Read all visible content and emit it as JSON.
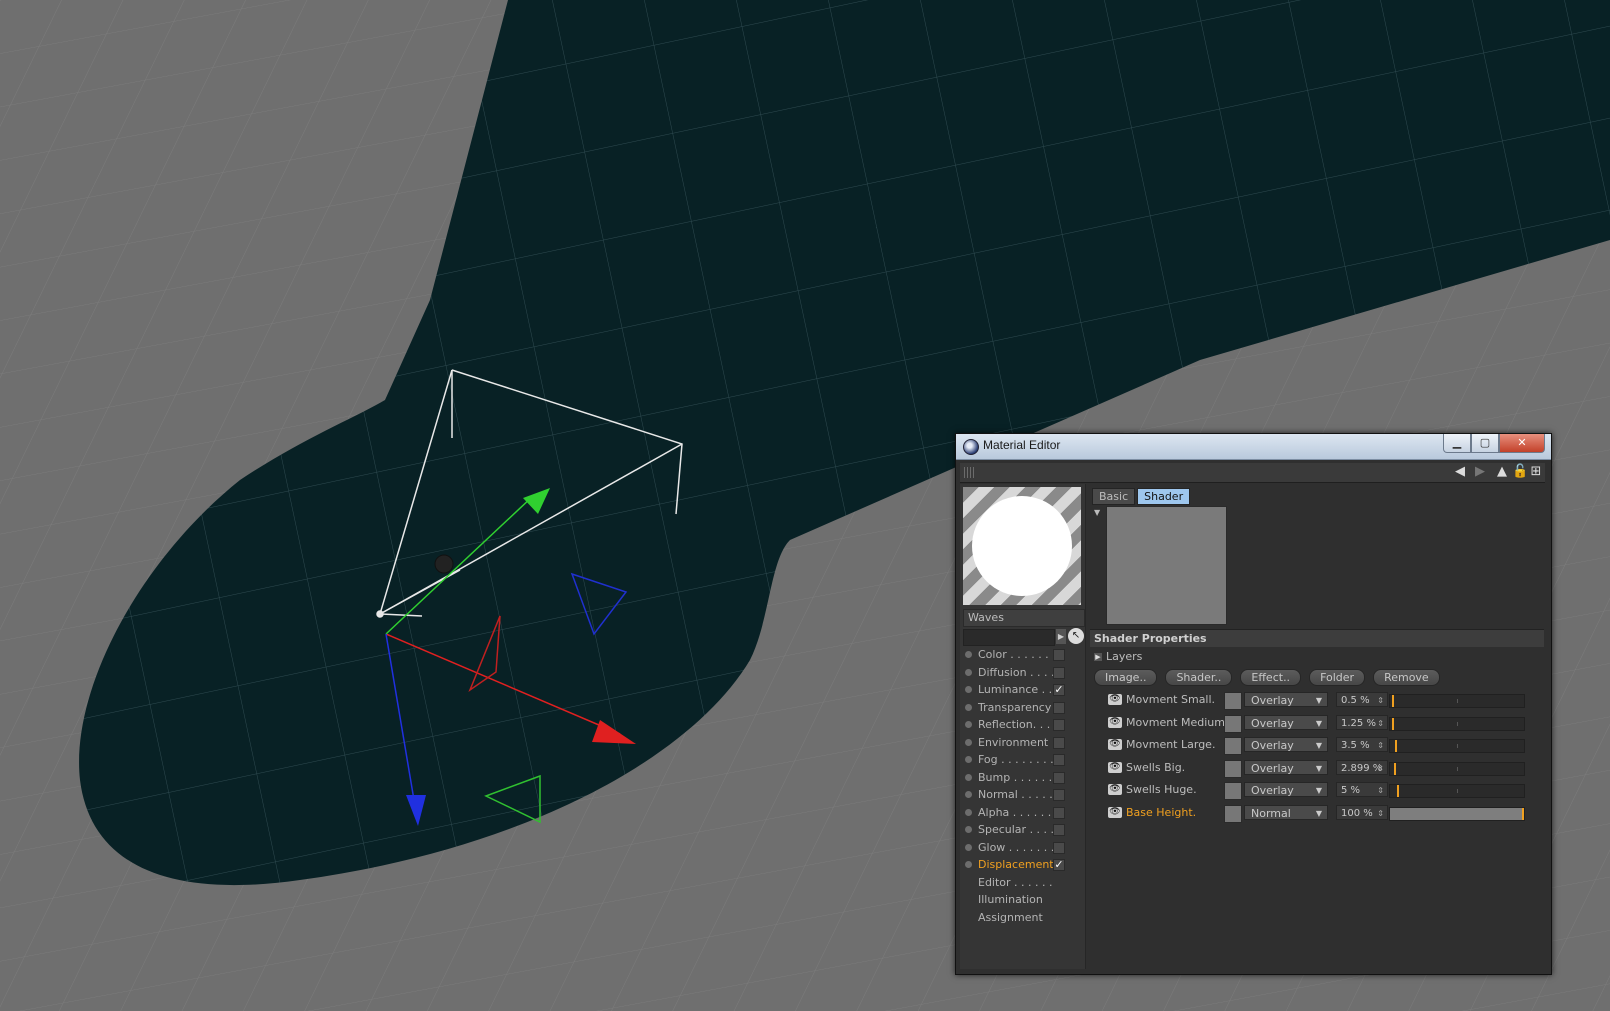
{
  "window": {
    "title": "Material Editor",
    "buttons": {
      "minimize": "▁",
      "maximize": "▢",
      "close": "✕"
    }
  },
  "material": {
    "name": "Waves"
  },
  "channels": [
    {
      "label": "Color . . . . . . .",
      "checked": false,
      "active": false,
      "has_checkbox": true
    },
    {
      "label": "Diffusion . . . . .",
      "checked": false,
      "active": false,
      "has_checkbox": true
    },
    {
      "label": "Luminance . . .",
      "checked": true,
      "active": false,
      "has_checkbox": true
    },
    {
      "label": "Transparency",
      "checked": false,
      "active": false,
      "has_checkbox": true
    },
    {
      "label": "Reflection. . . .",
      "checked": false,
      "active": false,
      "has_checkbox": true
    },
    {
      "label": "Environment",
      "checked": false,
      "active": false,
      "has_checkbox": true
    },
    {
      "label": "Fog . . . . . . . . .",
      "checked": false,
      "active": false,
      "has_checkbox": true
    },
    {
      "label": "Bump . . . . . . .",
      "checked": false,
      "active": false,
      "has_checkbox": true
    },
    {
      "label": "Normal . . . . . .",
      "checked": false,
      "active": false,
      "has_checkbox": true
    },
    {
      "label": "Alpha . . . . . . .",
      "checked": false,
      "active": false,
      "has_checkbox": true
    },
    {
      "label": "Specular . . . . .",
      "checked": false,
      "active": false,
      "has_checkbox": true
    },
    {
      "label": "Glow . . . . . . . .",
      "checked": false,
      "active": false,
      "has_checkbox": true
    },
    {
      "label": "Displacement",
      "checked": true,
      "active": true,
      "has_checkbox": true
    },
    {
      "label": "Editor . . . . . .",
      "checked": false,
      "active": false,
      "has_checkbox": false
    },
    {
      "label": "Illumination",
      "checked": false,
      "active": false,
      "has_checkbox": false
    },
    {
      "label": "Assignment",
      "checked": false,
      "active": false,
      "has_checkbox": false
    }
  ],
  "tabs": [
    {
      "label": "Basic",
      "active": false
    },
    {
      "label": "Shader",
      "active": true
    }
  ],
  "shader_properties": {
    "heading": "Shader Properties",
    "layers_label": "Layers",
    "buttons": [
      "Image..",
      "Shader..",
      "Effect..",
      "Folder",
      "Remove"
    ],
    "layers": [
      {
        "name": "Movment Small.",
        "mode": "Overlay",
        "value": "0.5 %",
        "amount": 0.005,
        "active": false
      },
      {
        "name": "Movment Medium.",
        "mode": "Overlay",
        "value": "1.25 %",
        "amount": 0.0125,
        "active": false
      },
      {
        "name": "Movment Large.",
        "mode": "Overlay",
        "value": "3.5 %",
        "amount": 0.035,
        "active": false
      },
      {
        "name": "Swells Big.",
        "mode": "Overlay",
        "value": "2.899 %",
        "amount": 0.02899,
        "active": false
      },
      {
        "name": "Swells Huge.",
        "mode": "Overlay",
        "value": "5 %",
        "amount": 0.05,
        "active": false
      },
      {
        "name": "Base Height.",
        "mode": "Normal",
        "value": "100 %",
        "amount": 1.0,
        "active": true
      }
    ]
  },
  "colors": {
    "accent_orange": "#f0a020",
    "viewport_floor": "#6f6f6f",
    "water_surface": "#082125",
    "axis_x": "#e02020",
    "axis_y": "#30d030",
    "axis_z": "#2030e0",
    "tab_active": "#9ec7ee"
  }
}
